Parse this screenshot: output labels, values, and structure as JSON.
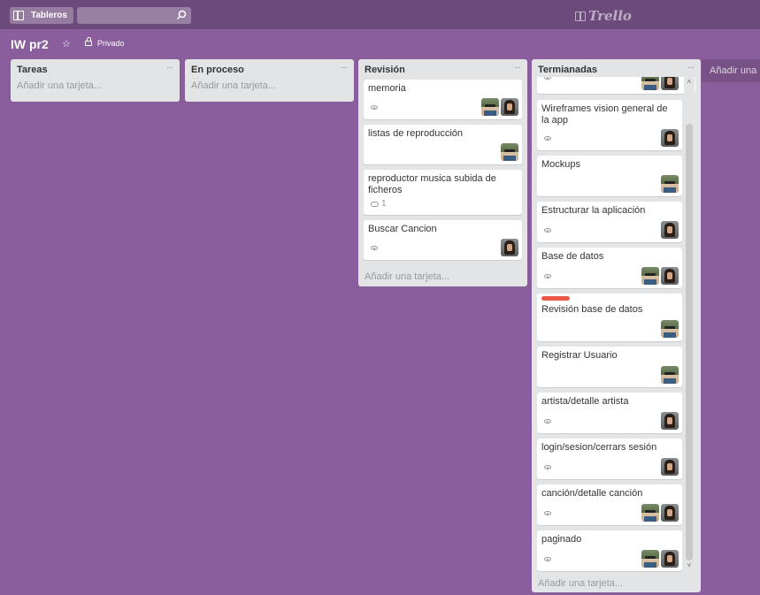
{
  "topbar": {
    "boards_label": "Tableros",
    "search_value": "",
    "logo_text": "Trello"
  },
  "board": {
    "title": "IW pr2",
    "privacy": "Privado"
  },
  "lists": [
    {
      "title": "Tareas",
      "add_card": "Añadir una tarjeta...",
      "cards": []
    },
    {
      "title": "En proceso",
      "add_card": "Añadir una tarjeta...",
      "cards": []
    },
    {
      "title": "Revisión",
      "add_card": "Añadir una tarjeta...",
      "cards": [
        {
          "title": "memoria",
          "badges": [
            "watch-icon"
          ],
          "members": [
            "member-1",
            "member-2"
          ]
        },
        {
          "title": "listas de reproducción",
          "badges": [],
          "members": [
            "member-1"
          ]
        },
        {
          "title": "reproductor musica subida de ficheros",
          "badges": [
            "comment-icon"
          ],
          "comments": "1",
          "members": []
        },
        {
          "title": "Buscar Cancion",
          "badges": [
            "watch-icon"
          ],
          "members": [
            "member-2"
          ]
        }
      ]
    },
    {
      "title": "Termianadas",
      "add_card": "Añadir una tarjeta...",
      "cards": [
        {
          "title": "",
          "badges": [
            "watch-icon"
          ],
          "members": [
            "member-1",
            "member-2"
          ]
        },
        {
          "title": "Wireframes vision general de la app",
          "badges": [
            "watch-icon"
          ],
          "members": [
            "member-2"
          ]
        },
        {
          "title": "Mockups",
          "badges": [],
          "members": [
            "member-1"
          ]
        },
        {
          "title": "Estructurar la aplicación",
          "badges": [
            "watch-icon"
          ],
          "members": [
            "member-2"
          ]
        },
        {
          "title": "Base de datos",
          "badges": [
            "watch-icon"
          ],
          "members": [
            "member-1",
            "member-2"
          ]
        },
        {
          "title": "Revisión base de datos",
          "labels": [
            "#eb5a46"
          ],
          "badges": [],
          "members": [
            "member-1"
          ]
        },
        {
          "title": "Registrar Usuario",
          "badges": [],
          "members": [
            "member-1"
          ]
        },
        {
          "title": "artista/detalle artista",
          "badges": [
            "watch-icon"
          ],
          "members": [
            "member-2"
          ]
        },
        {
          "title": "login/sesion/cerrars sesión",
          "badges": [
            "watch-icon"
          ],
          "members": [
            "member-2"
          ]
        },
        {
          "title": "canción/detalle canción",
          "badges": [
            "watch-icon"
          ],
          "members": [
            "member-1",
            "member-2"
          ]
        },
        {
          "title": "paginado",
          "badges": [
            "watch-icon"
          ],
          "members": [
            "member-1",
            "member-2"
          ]
        }
      ]
    }
  ],
  "add_list_label": "Añadir una lis",
  "colors": {
    "background": "#8a5e9c",
    "header": "#6c4a7c",
    "list": "#e2e4e6",
    "label_red": "#eb5a46"
  }
}
